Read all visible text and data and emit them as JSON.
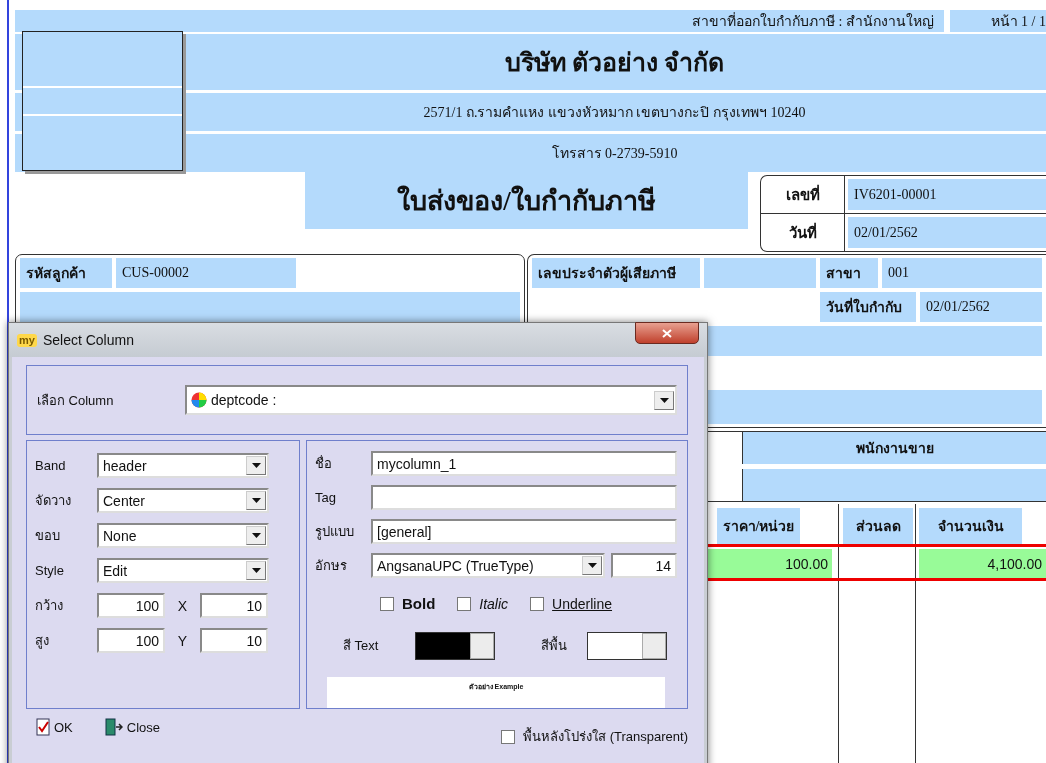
{
  "header": {
    "branch": "สาขาที่ออกใบกำกับภาษี : สำนักงานใหญ่",
    "page": "หน้า 1 / 1"
  },
  "company": {
    "name": "บริษัท ตัวอย่าง จำกัด",
    "address": "2571/1 ถ.รามคำแหง แขวงหัวหมาก เขตบางกะปิ กรุงเทพฯ 10240",
    "fax": "โทรสาร 0-2739-5910"
  },
  "document": {
    "title": "ใบส่งของ/ใบกำกับภาษี",
    "fields": [
      {
        "label": "เลขที่",
        "value": "IV6201-00001"
      },
      {
        "label": "วันที่",
        "value": "02/01/2562"
      }
    ]
  },
  "customer": {
    "code_label": "รหัสลูกค้า",
    "code": "CUS-00002"
  },
  "tax": {
    "tax_id_label": "เลขประจำตัวผู้เสียภาษี",
    "branch_label": "สาขา",
    "branch": "001",
    "invoice_date_label": "วันที่ใบกำกับ",
    "invoice_date": "02/01/2562"
  },
  "salesperson_label": "พนักงานขาย",
  "table": {
    "columns": [
      "ราคา/หน่วย",
      "ส่วนลด",
      "จำนวนเงิน"
    ],
    "rows": [
      {
        "unit_price": "100.00",
        "amount": "4,100.00"
      }
    ]
  },
  "dialog": {
    "app_icon": "my",
    "title": "Select Column",
    "column_select": {
      "label": "เลือก Column",
      "value": "deptcode :"
    },
    "left_fields": [
      {
        "kind": "select",
        "label": "Band",
        "value": "header"
      },
      {
        "kind": "select",
        "label": "จัดวาง",
        "value": "Center"
      },
      {
        "kind": "select",
        "label": "ขอบ",
        "value": "None"
      },
      {
        "kind": "select",
        "label": "Style",
        "value": "Edit"
      },
      {
        "kind": "pair",
        "label": "กว้าง",
        "value": "100",
        "axis": "X",
        "axis_value": "10"
      },
      {
        "kind": "pair",
        "label": "สูง",
        "value": "100",
        "axis": "Y",
        "axis_value": "10"
      }
    ],
    "right_fields": [
      {
        "kind": "text",
        "label": "ชื่อ",
        "value": "mycolumn_1"
      },
      {
        "kind": "text",
        "label": "Tag"
      },
      {
        "kind": "text",
        "label": "รูปแบบ",
        "value": "[general]"
      },
      {
        "kind": "font",
        "label": "อักษร",
        "value": "AngsanaUPC (TrueType)",
        "size": "14"
      }
    ],
    "styles": [
      {
        "kind": "bold",
        "label": "Bold",
        "checked": false
      },
      {
        "kind": "italic",
        "label": "Italic",
        "checked": false
      },
      {
        "kind": "underline",
        "label": "Underline",
        "checked": false
      }
    ],
    "colors": [
      {
        "label": "สี Text",
        "color": "#000000"
      },
      {
        "label": "สีพื้น",
        "color": "#ffffff"
      }
    ],
    "preview": "ตัวอย่าง Example",
    "buttons": [
      {
        "kind": "ok",
        "label": "OK"
      },
      {
        "kind": "close",
        "label": "Close"
      }
    ],
    "transparent": {
      "label": "พื้นหลังโปร่งใส (Transparent)",
      "checked": false
    }
  }
}
